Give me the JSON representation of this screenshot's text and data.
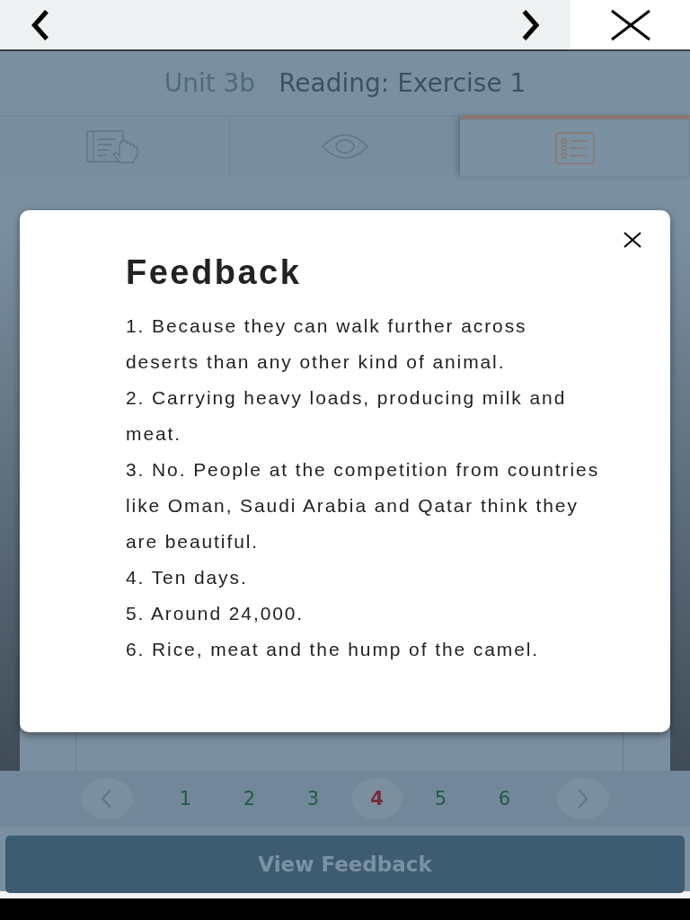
{
  "header": {
    "unit": "Unit 3b",
    "title": "Reading: Exercise 1"
  },
  "tabs": [
    {
      "kind": "instructions",
      "selected": false
    },
    {
      "kind": "view",
      "selected": false
    },
    {
      "kind": "list",
      "selected": true
    }
  ],
  "dialog": {
    "title": "Feedback",
    "answers": [
      "1. Because they can walk further across deserts than any other kind of animal.",
      "2. Carrying heavy loads, producing milk and meat.",
      "3. No. People at the competition from countries like Oman, Saudi Arabia and Qatar think they are beautiful.",
      "4. Ten days.",
      "5. Around 24,000.",
      "6. Rice, meat and the hump of the camel."
    ]
  },
  "pagination": [
    {
      "label": "1",
      "selected": false
    },
    {
      "label": "2",
      "selected": false
    },
    {
      "label": "3",
      "selected": false
    },
    {
      "label": "4",
      "selected": true
    },
    {
      "label": "5",
      "selected": false
    },
    {
      "label": "6",
      "selected": false
    }
  ],
  "action_button": "View Feedback"
}
